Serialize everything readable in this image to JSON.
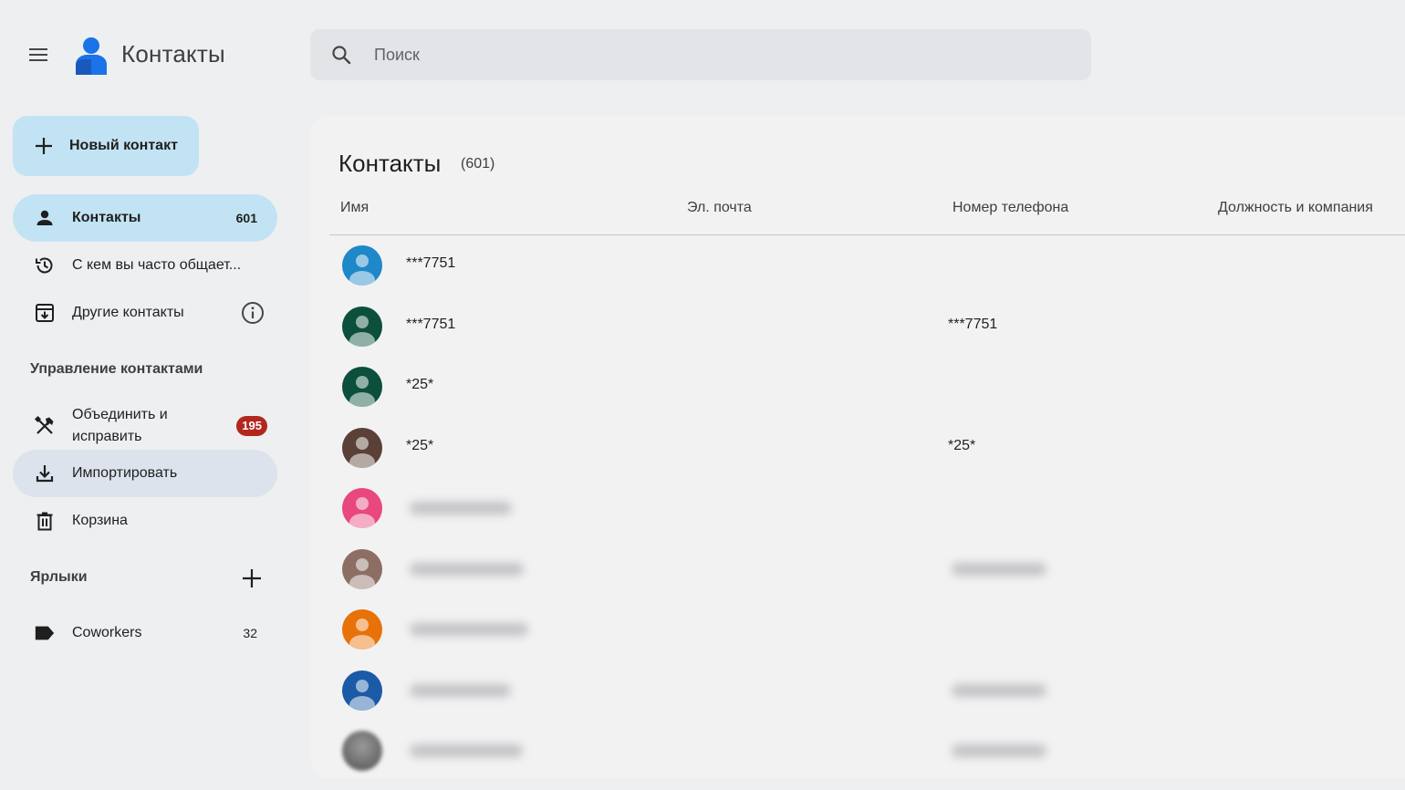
{
  "header": {
    "app_title": "Контакты",
    "search_placeholder": "Поиск"
  },
  "sidebar": {
    "new_contact_label": "Новый контакт",
    "items": [
      {
        "label": "Контакты",
        "count": "601",
        "icon": "person-icon"
      },
      {
        "label": "С кем вы часто общает...",
        "icon": "history-icon"
      },
      {
        "label": "Другие контакты",
        "icon": "archive-download-icon"
      }
    ],
    "manage_title": "Управление контактами",
    "manage_items": [
      {
        "label_line1": "Объединить и",
        "label_line2": "исправить",
        "badge": "195",
        "icon": "tools-icon"
      },
      {
        "label": "Импортировать",
        "icon": "download-icon"
      },
      {
        "label": "Корзина",
        "icon": "trash-icon"
      }
    ],
    "labels_title": "Ярлыки",
    "labels": [
      {
        "label": "Coworkers",
        "count": "32",
        "icon": "label-icon"
      }
    ]
  },
  "main": {
    "title": "Контакты",
    "count": "(601)",
    "columns": [
      "Имя",
      "Эл. почта",
      "Номер телефона",
      "Должность и компания"
    ],
    "rows": [
      {
        "name": "***7751",
        "phone": "",
        "avatar_color": "#1e88c8"
      },
      {
        "name": "***7751",
        "phone": "***7751",
        "avatar_color": "#0b4f3c"
      },
      {
        "name": "*25*",
        "phone": "",
        "avatar_color": "#0b4f3c"
      },
      {
        "name": "*25*",
        "phone": "*25*",
        "avatar_color": "#5b4037"
      },
      {
        "name": "",
        "phone": "",
        "avatar_color": "#e8487e"
      },
      {
        "name": "",
        "phone": "",
        "avatar_color": "#8d6e63"
      },
      {
        "name": "",
        "phone": "",
        "avatar_color": "#e8710a"
      },
      {
        "name": "",
        "phone": "",
        "avatar_color": "#1b5aa6"
      },
      {
        "name": "",
        "phone": "",
        "avatar_color": "#6b6b6b"
      }
    ]
  },
  "colors": {
    "accent_light": "#c2e3f3",
    "badge_red": "#b3261e",
    "logo_blue": "#1a73e8"
  }
}
